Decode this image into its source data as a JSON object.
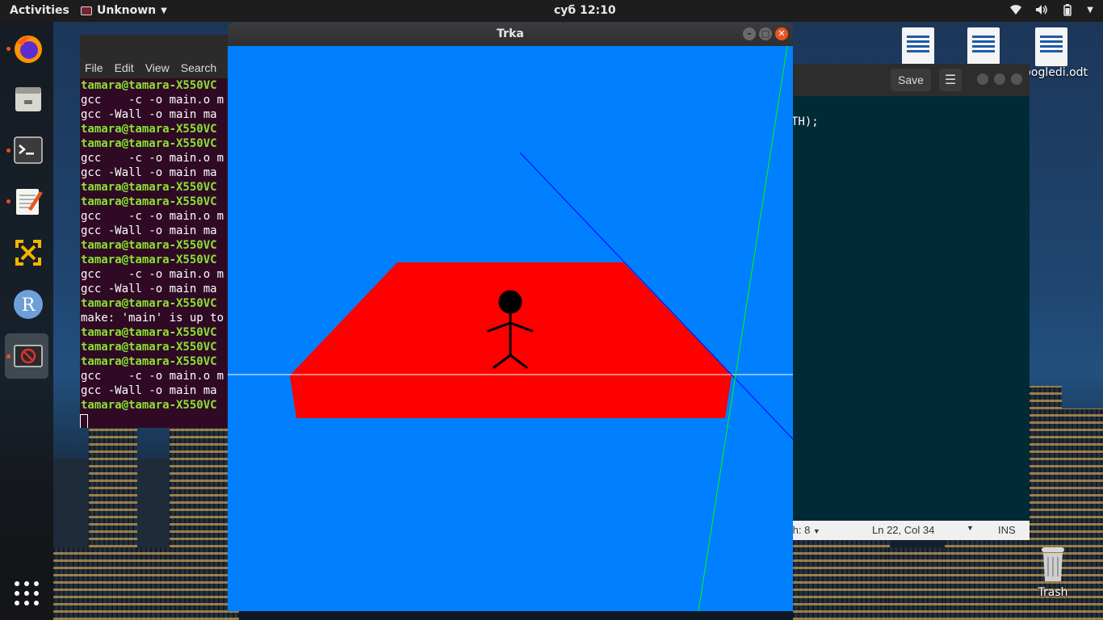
{
  "topbar": {
    "activities": "Activities",
    "app_menu": "Unknown",
    "clock": "суб 12:10"
  },
  "dock": {
    "items": [
      {
        "name": "firefox",
        "icon": "firefox-icon"
      },
      {
        "name": "files",
        "icon": "files-icon"
      },
      {
        "name": "terminal",
        "icon": "terminal-icon"
      },
      {
        "name": "text-editor",
        "icon": "text-editor-icon"
      },
      {
        "name": "vmware",
        "icon": "vmware-icon"
      },
      {
        "name": "r",
        "icon": "r-icon",
        "letter": "R"
      },
      {
        "name": "trka",
        "icon": "no-entry-icon"
      }
    ],
    "show_apps_icon": "grid-icon"
  },
  "desktop": {
    "files": [
      {
        "label": ""
      },
      {
        "label": ""
      },
      {
        "label": "pogledi.odt"
      }
    ],
    "trash": "Trash"
  },
  "terminal": {
    "menu": [
      "File",
      "Edit",
      "View",
      "Search"
    ],
    "lines": [
      {
        "text": "tamara@tamara-X550VC",
        "prompt": true
      },
      {
        "text": "gcc    -c -o main.o m",
        "prompt": false
      },
      {
        "text": "gcc -Wall -o main ma",
        "prompt": false
      },
      {
        "text": "tamara@tamara-X550VC",
        "prompt": true
      },
      {
        "text": "tamara@tamara-X550VC",
        "prompt": true
      },
      {
        "text": "gcc    -c -o main.o m",
        "prompt": false
      },
      {
        "text": "gcc -Wall -o main ma",
        "prompt": false
      },
      {
        "text": "tamara@tamara-X550VC",
        "prompt": true
      },
      {
        "text": "tamara@tamara-X550VC",
        "prompt": true
      },
      {
        "text": "gcc    -c -o main.o m",
        "prompt": false
      },
      {
        "text": "gcc -Wall -o main ma",
        "prompt": false
      },
      {
        "text": "tamara@tamara-X550VC",
        "prompt": true
      },
      {
        "text": "tamara@tamara-X550VC",
        "prompt": true
      },
      {
        "text": "gcc    -c -o main.o m",
        "prompt": false
      },
      {
        "text": "gcc -Wall -o main ma",
        "prompt": false
      },
      {
        "text": "tamara@tamara-X550VC",
        "prompt": true
      },
      {
        "text": "make: 'main' is up to",
        "prompt": false
      },
      {
        "text": "tamara@tamara-X550VC",
        "prompt": true
      },
      {
        "text": "tamara@tamara-X550VC",
        "prompt": true
      },
      {
        "text": "tamara@tamara-X550VC",
        "prompt": true
      },
      {
        "text": "gcc    -c -o main.o m",
        "prompt": false
      },
      {
        "text": "gcc -Wall -o main ma",
        "prompt": false
      },
      {
        "text": "tamara@tamara-X550VC",
        "prompt": true
      }
    ]
  },
  "editor": {
    "save_label": "Save",
    "menu_icon": "hamburger-icon",
    "code_visible": "TH);",
    "status": {
      "tab_width": "th: 8",
      "position": "Ln 22, Col 34",
      "mode": "INS"
    }
  },
  "trka": {
    "title": "Trka",
    "colors": {
      "sky": "#007fff",
      "track": "#ff0000",
      "figure": "#000000",
      "x_axis": "#ffffff",
      "y_axis": "#00ff00",
      "z_axis": "#0000ff"
    }
  }
}
